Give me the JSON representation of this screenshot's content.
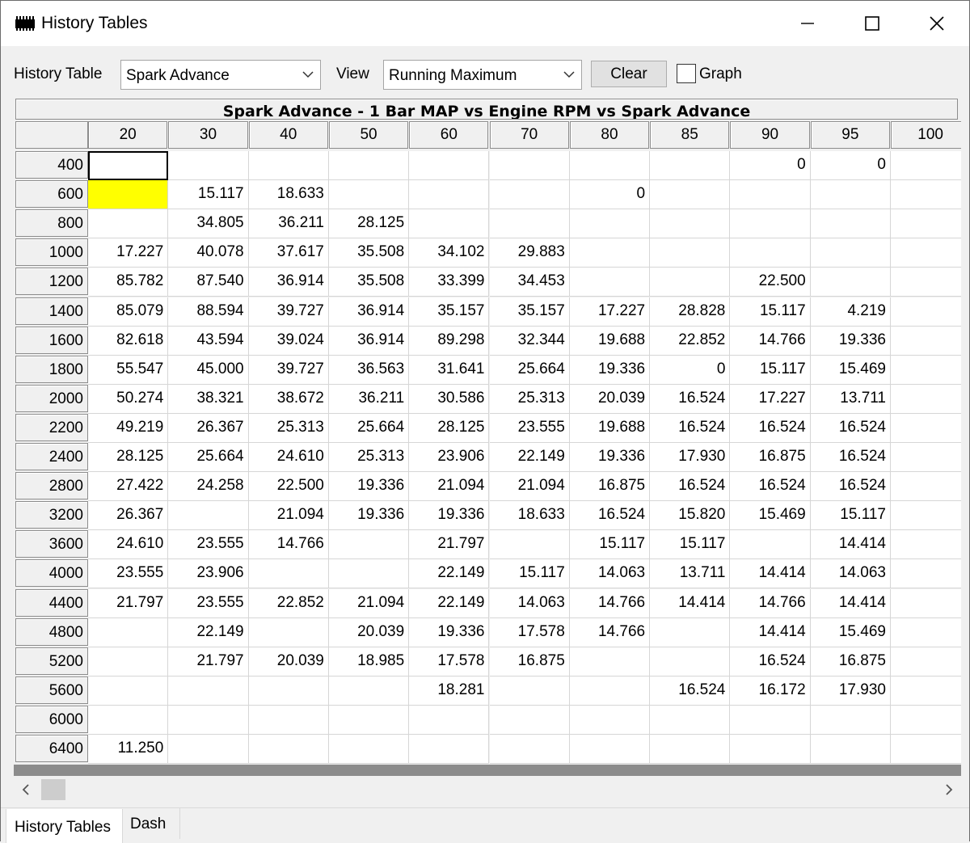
{
  "window": {
    "title": "History Tables",
    "minimize_glyph": "—",
    "maximize_glyph": "☐",
    "close_glyph": "✕",
    "app_icon": "chip-icon"
  },
  "toolbar": {
    "history_table_label": "History Table",
    "history_table_value": "Spark Advance",
    "view_label": "View",
    "view_value": "Running Maximum",
    "clear_label": "Clear",
    "graph_label": "Graph",
    "graph_checked": false
  },
  "table": {
    "title": "Spark Advance - 1 Bar MAP vs Engine RPM vs Spark Advance",
    "columns": [
      "20",
      "30",
      "40",
      "50",
      "60",
      "70",
      "80",
      "85",
      "90",
      "95",
      "100"
    ],
    "rows": [
      {
        "rpm": "400",
        "cells": [
          "",
          "",
          "",
          "",
          "",
          "",
          "",
          "",
          "0",
          "0",
          ""
        ]
      },
      {
        "rpm": "600",
        "cells": [
          "",
          "15.117",
          "18.633",
          "",
          "",
          "",
          "0",
          "",
          "",
          "",
          ""
        ]
      },
      {
        "rpm": "800",
        "cells": [
          "",
          "34.805",
          "36.211",
          "28.125",
          "",
          "",
          "",
          "",
          "",
          "",
          ""
        ]
      },
      {
        "rpm": "1000",
        "cells": [
          "17.227",
          "40.078",
          "37.617",
          "35.508",
          "34.102",
          "29.883",
          "",
          "",
          "",
          "",
          ""
        ]
      },
      {
        "rpm": "1200",
        "cells": [
          "85.782",
          "87.540",
          "36.914",
          "35.508",
          "33.399",
          "34.453",
          "",
          "",
          "22.500",
          "",
          ""
        ]
      },
      {
        "rpm": "1400",
        "cells": [
          "85.079",
          "88.594",
          "39.727",
          "36.914",
          "35.157",
          "35.157",
          "17.227",
          "28.828",
          "15.117",
          "4.219",
          ""
        ]
      },
      {
        "rpm": "1600",
        "cells": [
          "82.618",
          "43.594",
          "39.024",
          "36.914",
          "89.298",
          "32.344",
          "19.688",
          "22.852",
          "14.766",
          "19.336",
          ""
        ]
      },
      {
        "rpm": "1800",
        "cells": [
          "55.547",
          "45.000",
          "39.727",
          "36.563",
          "31.641",
          "25.664",
          "19.336",
          "0",
          "15.117",
          "15.469",
          ""
        ]
      },
      {
        "rpm": "2000",
        "cells": [
          "50.274",
          "38.321",
          "38.672",
          "36.211",
          "30.586",
          "25.313",
          "20.039",
          "16.524",
          "17.227",
          "13.711",
          ""
        ]
      },
      {
        "rpm": "2200",
        "cells": [
          "49.219",
          "26.367",
          "25.313",
          "25.664",
          "28.125",
          "23.555",
          "19.688",
          "16.524",
          "16.524",
          "16.524",
          ""
        ]
      },
      {
        "rpm": "2400",
        "cells": [
          "28.125",
          "25.664",
          "24.610",
          "25.313",
          "23.906",
          "22.149",
          "19.336",
          "17.930",
          "16.875",
          "16.524",
          ""
        ]
      },
      {
        "rpm": "2800",
        "cells": [
          "27.422",
          "24.258",
          "22.500",
          "19.336",
          "21.094",
          "21.094",
          "16.875",
          "16.524",
          "16.524",
          "16.524",
          ""
        ]
      },
      {
        "rpm": "3200",
        "cells": [
          "26.367",
          "",
          "21.094",
          "19.336",
          "19.336",
          "18.633",
          "16.524",
          "15.820",
          "15.469",
          "15.117",
          ""
        ]
      },
      {
        "rpm": "3600",
        "cells": [
          "24.610",
          "23.555",
          "14.766",
          "",
          "21.797",
          "",
          "15.117",
          "15.117",
          "",
          "14.414",
          ""
        ]
      },
      {
        "rpm": "4000",
        "cells": [
          "23.555",
          "23.906",
          "",
          "",
          "22.149",
          "15.117",
          "14.063",
          "13.711",
          "14.414",
          "14.063",
          ""
        ]
      },
      {
        "rpm": "4400",
        "cells": [
          "21.797",
          "23.555",
          "22.852",
          "21.094",
          "22.149",
          "14.063",
          "14.766",
          "14.414",
          "14.766",
          "14.414",
          ""
        ]
      },
      {
        "rpm": "4800",
        "cells": [
          "",
          "22.149",
          "",
          "20.039",
          "19.336",
          "17.578",
          "14.766",
          "",
          "14.414",
          "15.469",
          ""
        ]
      },
      {
        "rpm": "5200",
        "cells": [
          "",
          "21.797",
          "20.039",
          "18.985",
          "17.578",
          "16.875",
          "",
          "",
          "16.524",
          "16.875",
          ""
        ]
      },
      {
        "rpm": "5600",
        "cells": [
          "",
          "",
          "",
          "",
          "18.281",
          "",
          "",
          "16.524",
          "16.172",
          "17.930",
          ""
        ]
      },
      {
        "rpm": "6000",
        "cells": [
          "",
          "",
          "",
          "",
          "",
          "",
          "",
          "",
          "",
          "",
          ""
        ]
      },
      {
        "rpm": "6400",
        "cells": [
          "11.250",
          "",
          "",
          "",
          "",
          "",
          "",
          "",
          "",
          "",
          ""
        ]
      }
    ],
    "selected_cell": {
      "row": 0,
      "col": 0
    },
    "highlight_cell": {
      "row": 1,
      "col": 0,
      "color": "#ffff00"
    }
  },
  "scrollbar": {
    "left_glyph": "‹",
    "right_glyph": "›"
  },
  "tabs": [
    {
      "label": "History Tables",
      "active": true
    },
    {
      "label": "Dash",
      "active": false
    }
  ],
  "colors": {
    "background": "#f0f0f0",
    "header": "#f0f0f0",
    "cell": "#ffffff",
    "highlight": "#ffff00",
    "bottom_bar": "#8c8c8c"
  }
}
